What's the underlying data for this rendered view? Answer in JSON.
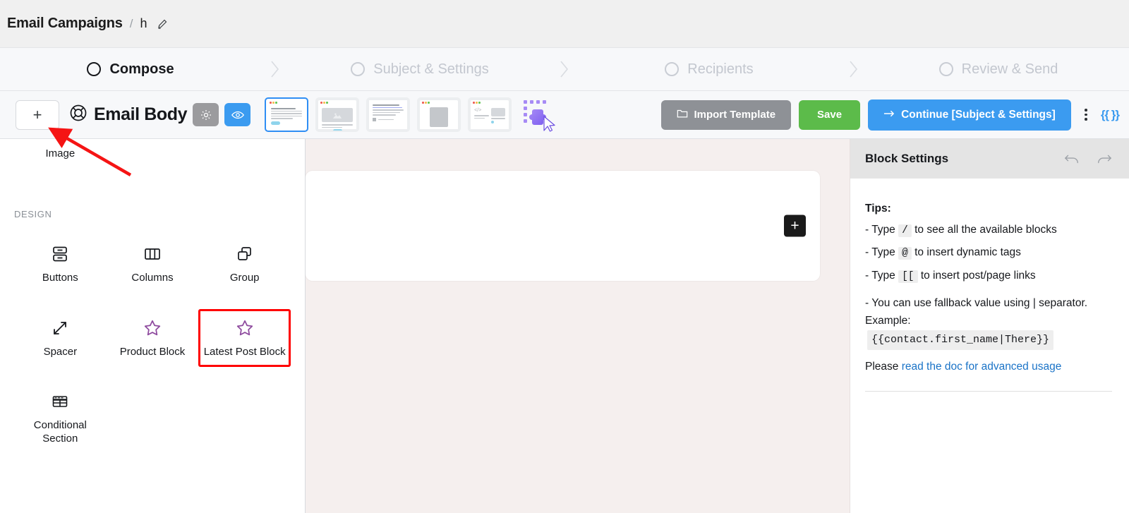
{
  "breadcrumb": {
    "root": "Email Campaigns",
    "separator": "/",
    "title": "h",
    "edit_icon": "pencil-icon"
  },
  "steps": [
    {
      "label": "Compose",
      "active": true
    },
    {
      "label": "Subject & Settings",
      "active": false
    },
    {
      "label": "Recipients",
      "active": false
    },
    {
      "label": "Review & Send",
      "active": false
    }
  ],
  "toolbar": {
    "add_block_label": "+",
    "body_title": "Email Body",
    "body_icon": "lifebuoy-icon",
    "settings_icon": "gear-icon",
    "preview_icon": "eye-icon",
    "thumbnails": [
      {
        "name": "layout-text-template",
        "selected": true
      },
      {
        "name": "layout-image-template",
        "selected": false
      },
      {
        "name": "layout-article-template",
        "selected": false
      },
      {
        "name": "layout-document-template",
        "selected": false
      },
      {
        "name": "layout-code-template",
        "selected": false
      }
    ],
    "plugin_icon": "plugin-cursor-icon",
    "import_label": "Import Template",
    "import_icon": "folder-icon",
    "save_label": "Save",
    "continue_label": "Continue [Subject & Settings]",
    "continue_icon": "arrow-right-icon",
    "kebab_icon": "more-vertical-icon",
    "merge_tag_label": "{{ }}"
  },
  "blocks_panel": {
    "top_items": [
      {
        "label": "Image",
        "icon": "image-icon"
      }
    ],
    "section_label": "DESIGN",
    "items": [
      {
        "label": "Buttons",
        "icon": "buttons-icon",
        "highlighted": false
      },
      {
        "label": "Columns",
        "icon": "columns-icon",
        "highlighted": false
      },
      {
        "label": "Group",
        "icon": "group-icon",
        "highlighted": false
      },
      {
        "label": "Spacer",
        "icon": "spacer-icon",
        "highlighted": false
      },
      {
        "label": "Product Block",
        "icon": "star-icon",
        "highlighted": false
      },
      {
        "label": "Latest Post Block",
        "icon": "star-icon",
        "highlighted": true
      },
      {
        "label": "Conditional Section",
        "icon": "table-icon",
        "highlighted": false
      }
    ]
  },
  "canvas": {
    "add_button_label": "+"
  },
  "settings": {
    "title": "Block Settings",
    "undo_icon": "undo-icon",
    "redo_icon": "redo-icon",
    "tips_title": "Tips:",
    "tips": [
      {
        "prefix": "- Type",
        "code": "/",
        "suffix": "to see all the available blocks"
      },
      {
        "prefix": "- Type",
        "code": "@",
        "suffix": "to insert dynamic tags"
      },
      {
        "prefix": "- Type",
        "code": "[[",
        "suffix": "to insert post/page links"
      }
    ],
    "fallback_text": "- You can use fallback value using | separator. Example:",
    "fallback_code": "{{contact.first_name|There}}",
    "doc_prefix": "Please ",
    "doc_link": "read the doc for advanced usage"
  },
  "colors": {
    "accent_blue": "#3b9bf0",
    "save_green": "#5cbb4a",
    "import_grey": "#8e9196",
    "canvas_bg": "#f5efee",
    "highlight_red": "#ff0000",
    "link_blue": "#1a73c7"
  }
}
